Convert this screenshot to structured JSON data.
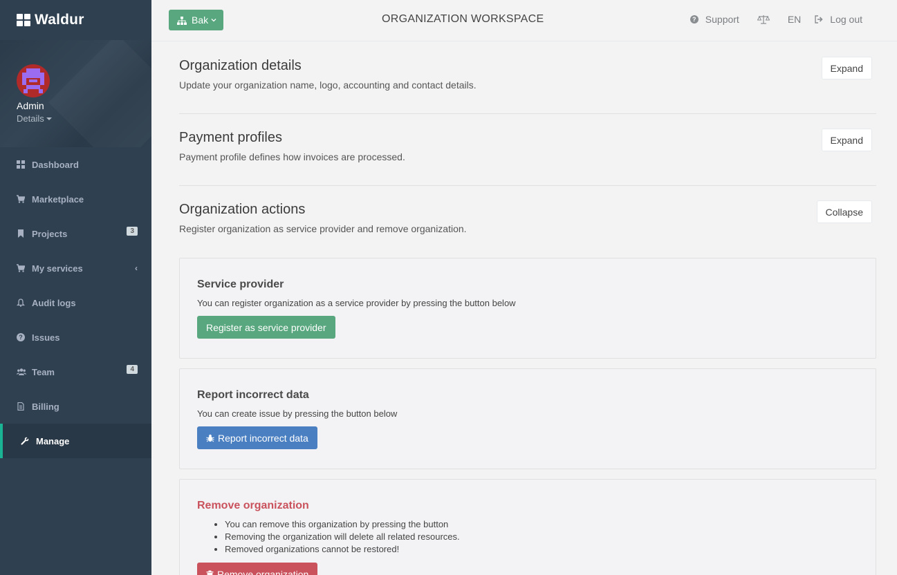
{
  "brand": {
    "name": "Waldur"
  },
  "profile": {
    "name": "Admin",
    "details_label": "Details"
  },
  "nav": {
    "items": [
      {
        "label": "Dashboard",
        "icon": "dashboard-icon"
      },
      {
        "label": "Marketplace",
        "icon": "cart-icon"
      },
      {
        "label": "Projects",
        "icon": "bookmark-icon",
        "badge": "3"
      },
      {
        "label": "My services",
        "icon": "cart-icon",
        "chevron": "‹"
      },
      {
        "label": "Audit logs",
        "icon": "bell-icon"
      },
      {
        "label": "Issues",
        "icon": "question-circle-icon"
      },
      {
        "label": "Team",
        "icon": "users-icon",
        "badge": "4"
      },
      {
        "label": "Billing",
        "icon": "document-icon"
      },
      {
        "label": "Manage",
        "icon": "wrench-icon",
        "active": true
      }
    ]
  },
  "topbar": {
    "workspace_button": "Bak",
    "title": "ORGANIZATION WORKSPACE",
    "support": "Support",
    "language": "EN",
    "logout": "Log out"
  },
  "sections": {
    "details": {
      "title": "Organization details",
      "description": "Update your organization name, logo, accounting and contact details.",
      "button": "Expand"
    },
    "payment": {
      "title": "Payment profiles",
      "description": "Payment profile defines how invoices are processed.",
      "button": "Expand"
    },
    "actions": {
      "title": "Organization actions",
      "description": "Register organization as service provider and remove organization.",
      "button": "Collapse"
    }
  },
  "panels": {
    "service_provider": {
      "title": "Service provider",
      "description": "You can register organization as a service provider by pressing the button below",
      "button": "Register as service provider"
    },
    "report": {
      "title": "Report incorrect data",
      "description": "You can create issue by pressing the button below",
      "button": "Report incorrect data"
    },
    "remove": {
      "title": "Remove organization",
      "bullets": [
        "You can remove this organization by pressing the button",
        "Removing the organization will delete all related resources.",
        "Removed organizations cannot be restored!"
      ],
      "button": "Remove organization"
    }
  },
  "colors": {
    "sidebar": "#2f4050",
    "accent_green": "#58a77e",
    "accent_blue": "#4a7fc1",
    "danger": "#c9525d"
  }
}
